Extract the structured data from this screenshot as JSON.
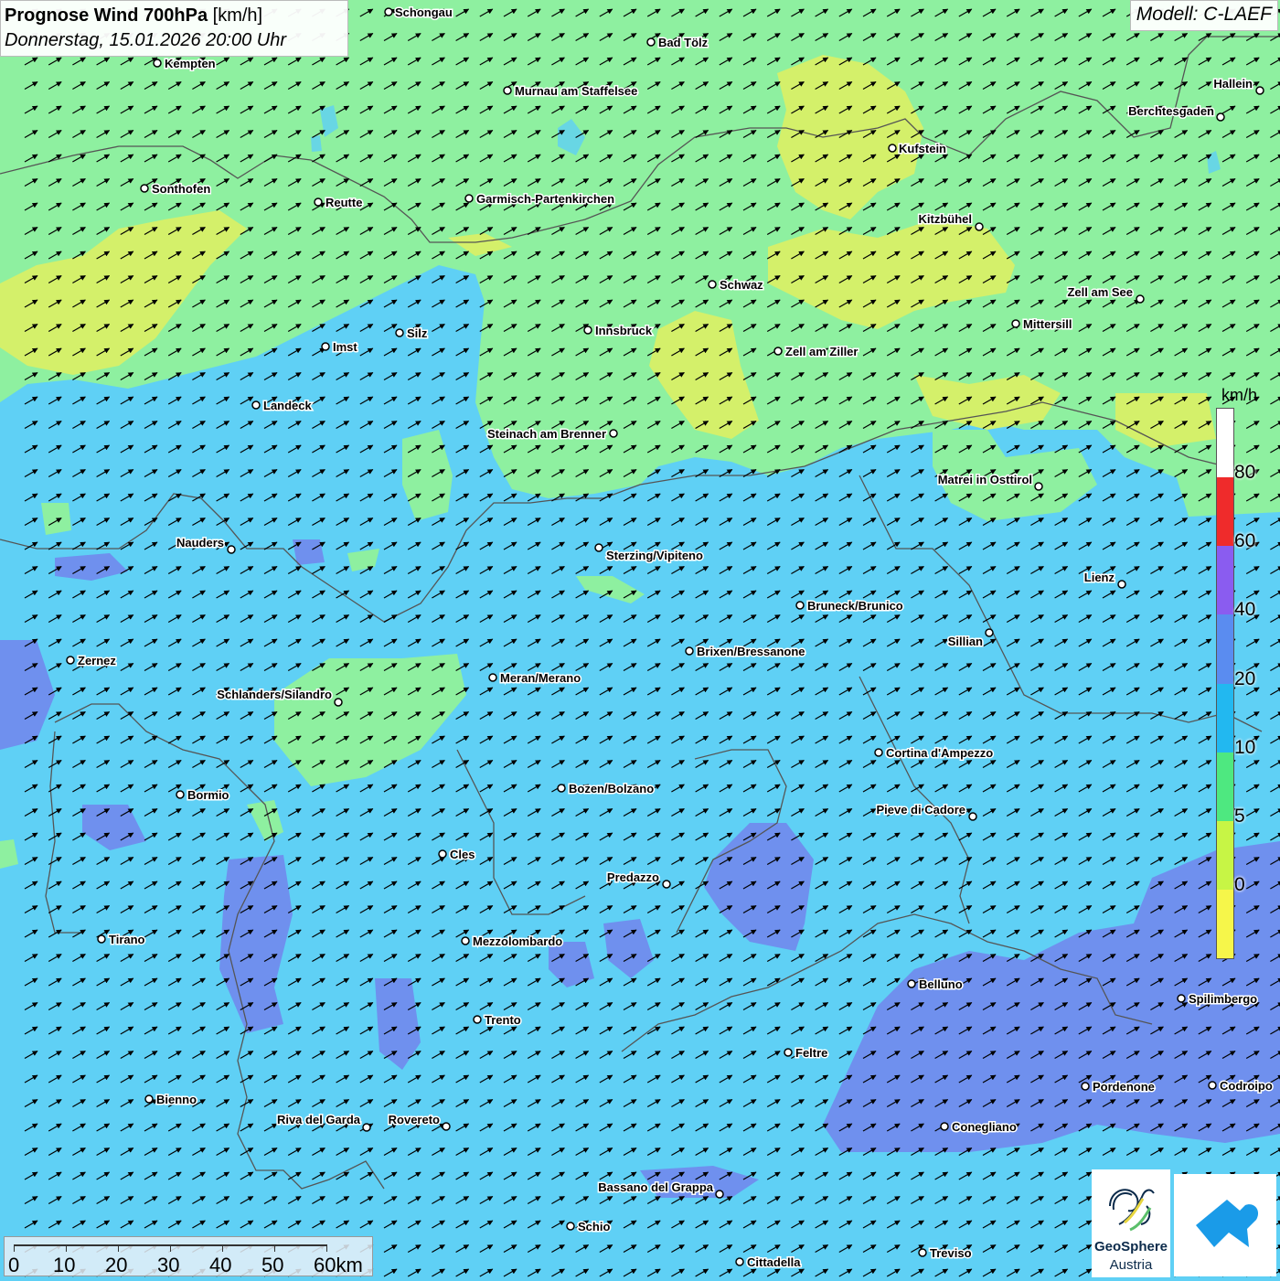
{
  "header": {
    "title_bold": "Prognose Wind 700hPa",
    "title_unit": "[km/h]",
    "subtitle": "Donnerstag, 15.01.2026 20:00 Uhr",
    "model": "Modell: C-LAEF"
  },
  "legend": {
    "unit": "km/h",
    "ticks": [
      "80",
      "60",
      "40",
      "20",
      "10",
      "5",
      "0"
    ],
    "colors": [
      "#ffffff",
      "#ef2b2b",
      "#8a5cf0",
      "#5a8cf0",
      "#22b8f0",
      "#4ee880",
      "#c7f545",
      "#f6f64a"
    ]
  },
  "scalebar": {
    "labels": [
      "0",
      "10",
      "20",
      "30",
      "40",
      "50",
      "60km"
    ]
  },
  "logos": {
    "geosphere_line1": "GeoSphere",
    "geosphere_line2": "Austria"
  },
  "colors": {
    "band_20_40": "#5fd0f5",
    "band_10_20": "#8ef0a0",
    "band_5_10": "#d4f06a",
    "band_40_60": "#6f90ee",
    "arrow": "#000000"
  },
  "wind": {
    "direction": "towards north-east"
  },
  "cities": [
    {
      "name": "Schongau"
    },
    {
      "name": "Bad Tölz"
    },
    {
      "name": "Kempten"
    },
    {
      "name": "Murnau am Staffelsee"
    },
    {
      "name": "Hallein"
    },
    {
      "name": "Berchtesgaden"
    },
    {
      "name": "Kufstein"
    },
    {
      "name": "Sonthofen"
    },
    {
      "name": "Reutte"
    },
    {
      "name": "Garmisch-Partenkirchen"
    },
    {
      "name": "Kitzbühel"
    },
    {
      "name": "Schwaz"
    },
    {
      "name": "Zell am See"
    },
    {
      "name": "Mittersill"
    },
    {
      "name": "Innsbruck"
    },
    {
      "name": "Imst"
    },
    {
      "name": "Silz"
    },
    {
      "name": "Zell am Ziller"
    },
    {
      "name": "Landeck"
    },
    {
      "name": "Steinach am Brenner"
    },
    {
      "name": "Matrei in Osttirol"
    },
    {
      "name": "Nauders"
    },
    {
      "name": "Sterzing/Vipiteno"
    },
    {
      "name": "Lienz"
    },
    {
      "name": "Bruneck/Brunico"
    },
    {
      "name": "Sillian"
    },
    {
      "name": "Zernez"
    },
    {
      "name": "Brixen/Bressanone"
    },
    {
      "name": "Meran/Merano"
    },
    {
      "name": "Schlanders/Silandro"
    },
    {
      "name": "Cortina d'Ampezzo"
    },
    {
      "name": "Bormio"
    },
    {
      "name": "Bozen/Bolzano"
    },
    {
      "name": "Pieve di Cadore"
    },
    {
      "name": "Cles"
    },
    {
      "name": "Predazzo"
    },
    {
      "name": "Tirano"
    },
    {
      "name": "Mezzolombardo"
    },
    {
      "name": "Belluno"
    },
    {
      "name": "Spilimbergo"
    },
    {
      "name": "Trento"
    },
    {
      "name": "Feltre"
    },
    {
      "name": "Pordenone"
    },
    {
      "name": "Codroipo"
    },
    {
      "name": "Bienno"
    },
    {
      "name": "Riva del Garda"
    },
    {
      "name": "Rovereto"
    },
    {
      "name": "Conegliano"
    },
    {
      "name": "Bassano del Grappa"
    },
    {
      "name": "Schio"
    },
    {
      "name": "Treviso"
    },
    {
      "name": "Cittadella"
    }
  ]
}
